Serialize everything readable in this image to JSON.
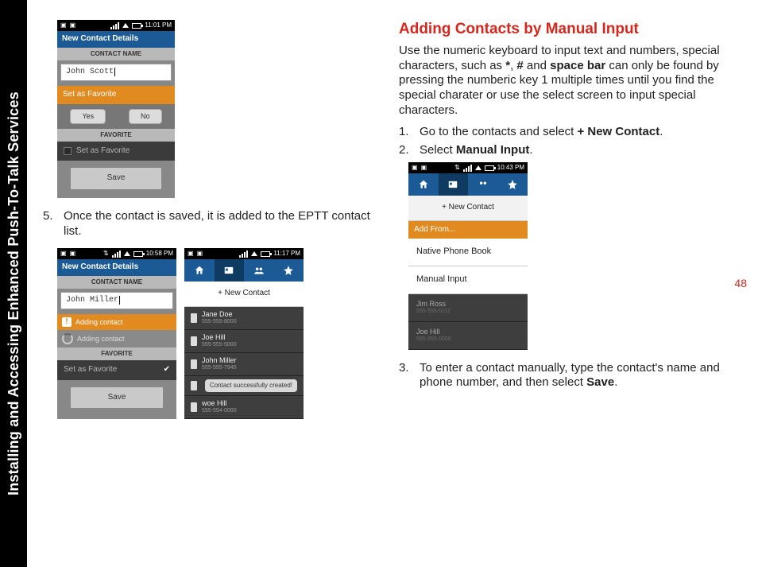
{
  "sidebar": {
    "title": "Installing and Accessing Enhanced Push-To-Talk Services"
  },
  "page_number": "48",
  "left": {
    "step5": "Once the contact is saved, it is added to the EPTT contact list."
  },
  "right": {
    "heading": "Adding Contacts by Manual Input",
    "intro_segments": [
      "Use the numeric keyboard to input text and numbers, special characters, such as ",
      "*",
      ", ",
      "#",
      " and ",
      "space bar",
      " can only be found by pressing the numberic key 1 multiple times until you find the special charater or use the select screen to input special characters."
    ],
    "step1_prefix": "Go to the contacts and select ",
    "step1_bold": "+ New Contact",
    "step1_suffix": ".",
    "step2_prefix": "Select ",
    "step2_bold": "Manual Input",
    "step2_suffix": ".",
    "step3_prefix": "To enter a contact manually, type the contact's name and phone number, and then select ",
    "step3_bold": "Save",
    "step3_suffix": "."
  },
  "phone1": {
    "time": "11:01 PM",
    "title": "New Contact Details",
    "band_name": "CONTACT NAME",
    "input_value": "John  Scott",
    "orange_label": "Set as Favorite",
    "yes": "Yes",
    "no": "No",
    "band_fav": "FAVORITE",
    "dark_label": "Set as Favorite",
    "save": "Save"
  },
  "phone2": {
    "time": "10:58 PM",
    "title": "New Contact Details",
    "band_name": "CONTACT NAME",
    "input_value": "John Miller",
    "adding": "Adding contact",
    "adding_fade": "Adding contact",
    "band_fav": "FAVORITE",
    "dark_label": "Set as Favorite",
    "save": "Save"
  },
  "phone3": {
    "time": "11:17 PM",
    "new_contact": "+ New Contact",
    "toast": "Contact successfully created!",
    "rows": [
      {
        "name": "Jane Doe",
        "num": "555-555-8000"
      },
      {
        "name": "Joe Hill",
        "num": "555-555-5000"
      },
      {
        "name": "John Miller",
        "num": "555-555-7945"
      },
      {
        "name": "",
        "num": ""
      },
      {
        "name": "woe Hill",
        "num": "555-554-0000"
      }
    ]
  },
  "phone4": {
    "time": "10:43 PM",
    "new_contact": "+ New Contact",
    "orange_label": "Add From...",
    "opt1": "Native Phone Book",
    "opt2": "Manual Input",
    "rows": [
      {
        "name": "Jim Ross",
        "num": "555-555-0112"
      },
      {
        "name": "Joe Hill",
        "num": "555-555-0000"
      }
    ]
  }
}
